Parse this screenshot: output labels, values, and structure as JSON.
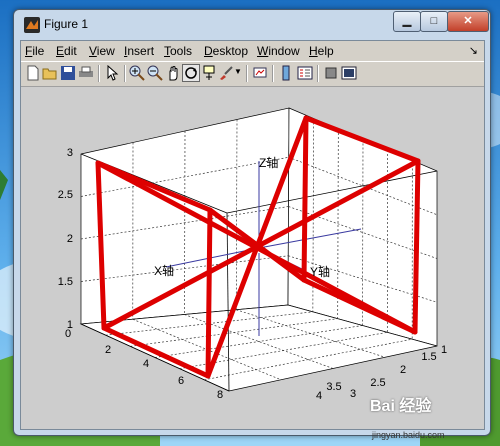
{
  "window": {
    "title": "Figure 1"
  },
  "menubar": [
    {
      "label": "File",
      "ul": "F",
      "rest": "ile"
    },
    {
      "label": "Edit",
      "ul": "E",
      "rest": "dit"
    },
    {
      "label": "View",
      "ul": "V",
      "rest": "iew"
    },
    {
      "label": "Insert",
      "ul": "I",
      "rest": "nsert"
    },
    {
      "label": "Tools",
      "ul": "T",
      "rest": "ools"
    },
    {
      "label": "Desktop",
      "ul": "D",
      "rest": "esktop"
    },
    {
      "label": "Window",
      "ul": "W",
      "rest": "indow"
    },
    {
      "label": "Help",
      "ul": "H",
      "rest": "elp"
    }
  ],
  "toolbar": [
    "new-figure-icon",
    "open-file-icon",
    "save-figure-icon",
    "print-figure-icon",
    "edit-plot-icon",
    "zoom-in-icon",
    "zoom-out-icon",
    "pan-icon",
    "rotate-3d-icon",
    "data-cursor-icon",
    "brush-icon",
    "link-plot-icon",
    "colorbar-icon",
    "legend-icon",
    "hide-plot-tools-icon",
    "show-plot-tools-icon"
  ],
  "chart_data": {
    "type": "3d-line",
    "z_ticks": [
      "1",
      "1.5",
      "2",
      "2.5",
      "3"
    ],
    "y_ticks": [
      "1",
      "1.5",
      "2",
      "2.5",
      "3",
      "3.5",
      "4"
    ],
    "x_ticks": [
      "0",
      "2",
      "4",
      "6",
      "8"
    ],
    "xlim": [
      0,
      8
    ],
    "ylim": [
      1,
      4
    ],
    "zlim": [
      1,
      3
    ],
    "grid": true,
    "line_color": "#dd0000",
    "annotations": {
      "z_axis": "Z轴",
      "x_axis": "X轴",
      "y_axis": "Y轴"
    }
  },
  "watermark": {
    "brand": "Bai 经验",
    "url": "jingyan.baidu.com"
  }
}
